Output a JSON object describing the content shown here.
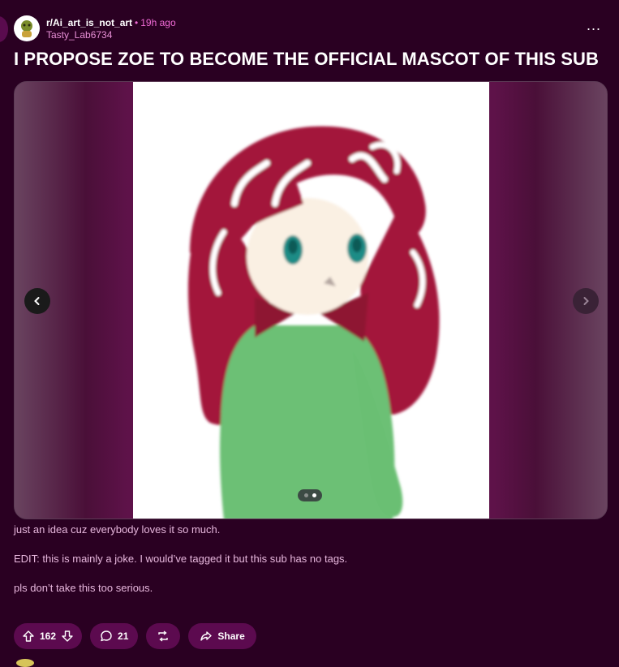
{
  "post": {
    "subreddit": "r/Ai_art_is_not_art",
    "time_ago": "19h ago",
    "separator": "•",
    "author": "Tasty_Lab6734",
    "title": "I PROPOSE ZOE TO BECOME THE OFFICIAL MASCOT OF THIS SUB",
    "more_label": "...",
    "gallery": {
      "prev_icon": "chevron-left-icon",
      "next_icon": "chevron-right-icon",
      "page_count": 2,
      "current_page": 2
    },
    "body": [
      "just an idea cuz everybody loves it so much.",
      "EDIT: this is mainly a joke. I would’ve tagged it but this sub has no tags.",
      "pls don’t take this too serious."
    ],
    "actions": {
      "upvote_icon": "arrow-up-icon",
      "vote_count": "162",
      "downvote_icon": "arrow-down-icon",
      "comment_icon": "comment-icon",
      "comment_count": "21",
      "crosspost_icon": "repost-icon",
      "share_icon": "share-icon",
      "share_label": "Share"
    }
  },
  "colors": {
    "background": "#2a0022",
    "accent": "#f06ad6",
    "action_pill": "#5c0a4f"
  }
}
